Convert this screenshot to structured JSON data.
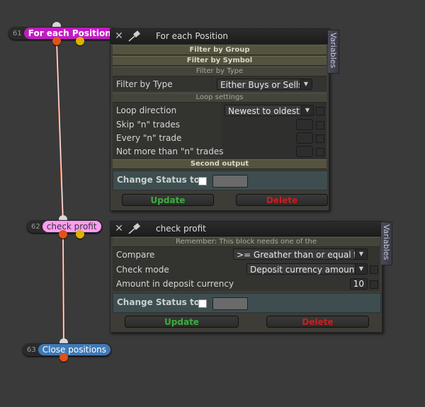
{
  "nodes": [
    {
      "num": "61",
      "label": "For each Position",
      "color": "#c21cc2",
      "text_color": "#ffffff"
    },
    {
      "num": "62",
      "label": "check profit",
      "color": "#ff9cf6",
      "text_color": "#333333"
    },
    {
      "num": "63",
      "label": "Close positions",
      "color": "#3f79b5",
      "text_color": "#ffffff"
    }
  ],
  "panel1": {
    "title": "For each Position",
    "vertical_tab": "Variables",
    "sections": {
      "filter_group": "Filter by Group",
      "filter_symbol": "Filter by Symbol",
      "filter_type": "Filter by Type",
      "loop_settings": "Loop settings",
      "second_output": "Second output"
    },
    "filter_type_label": "Filter by Type",
    "filter_type_value": "Either Buys or Sells",
    "loop_direction_label": "Loop direction",
    "loop_direction_value": "Newest to oldest",
    "skip_label": "Skip \"n\" trades",
    "every_label": "Every \"n\" trade",
    "not_more_label": "Not more than \"n\" trades",
    "change_status_label": "Change Status to",
    "update_label": "Update",
    "delete_label": "Delete"
  },
  "panel2": {
    "title": "check profit",
    "vertical_tab": "Variables",
    "remember_text": "Remember: This block needs one of the",
    "compare_label": "Compare",
    "compare_value": ">= Greather than or equal to",
    "check_mode_label": "Check mode",
    "check_mode_value": "Deposit currency amount",
    "amount_label": "Amount in deposit currency",
    "amount_value": "10",
    "change_status_label": "Change Status to",
    "update_label": "Update",
    "delete_label": "Delete"
  },
  "colors": {
    "background": "#3a3a3a",
    "wire_orange": "#e0521a",
    "wire_light": "#f0d8e8",
    "update_green": "#3cae3c",
    "delete_red": "#c82020"
  }
}
